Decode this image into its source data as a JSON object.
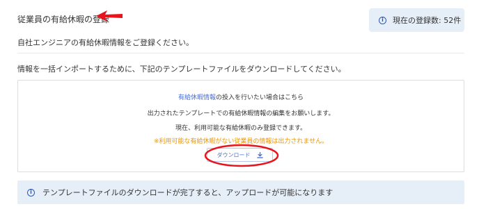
{
  "page": {
    "title": "従業員の有給休暇の登録",
    "subtitle": "自社エンジニアの有給休暇情報をご登録ください。",
    "instruction": "情報を一括インポートするために、下記のテンプレートファイルをダウンロードしてください。"
  },
  "count_badge": {
    "text": "現在の登録数: 52件",
    "icon": "info-icon"
  },
  "download_panel": {
    "link_text": "有給休暇情報",
    "link_suffix": "の投入を行いたい場合はこちら",
    "line2": "出力されたテンプレートでの有給休暇情報の編集をお願いします。",
    "line3": "現在、利用可能な有給休暇のみ登録できます。",
    "warning": "※利用可能な有給休暇がない従業員の情報は出力されません。",
    "button_label": "ダウンロード",
    "button_icon": "download-icon"
  },
  "bottom_notice": {
    "text": "テンプレートファイルのダウンロードが完了すると、アップロードが可能になります",
    "icon": "info-icon"
  },
  "colors": {
    "accent": "#4a6fd6",
    "info_bg": "#e6eef8",
    "warning": "#e8960c",
    "annotation_red": "#e8141c"
  }
}
